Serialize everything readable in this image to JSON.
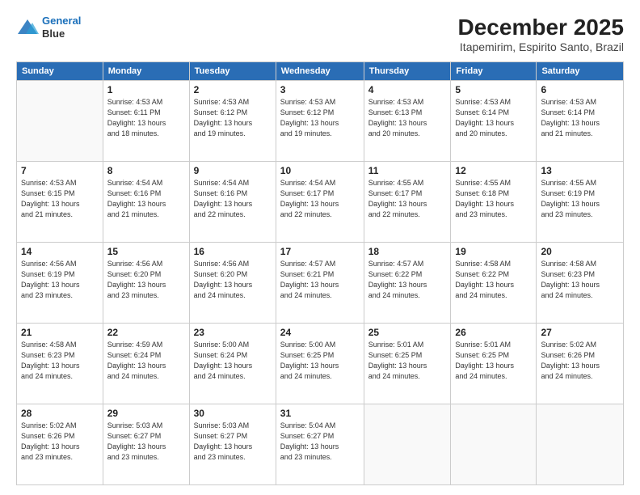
{
  "header": {
    "logo_line1": "General",
    "logo_line2": "Blue",
    "title": "December 2025",
    "subtitle": "Itapemirim, Espirito Santo, Brazil"
  },
  "calendar": {
    "days_of_week": [
      "Sunday",
      "Monday",
      "Tuesday",
      "Wednesday",
      "Thursday",
      "Friday",
      "Saturday"
    ],
    "weeks": [
      [
        {
          "day": "",
          "info": ""
        },
        {
          "day": "1",
          "info": "Sunrise: 4:53 AM\nSunset: 6:11 PM\nDaylight: 13 hours\nand 18 minutes."
        },
        {
          "day": "2",
          "info": "Sunrise: 4:53 AM\nSunset: 6:12 PM\nDaylight: 13 hours\nand 19 minutes."
        },
        {
          "day": "3",
          "info": "Sunrise: 4:53 AM\nSunset: 6:12 PM\nDaylight: 13 hours\nand 19 minutes."
        },
        {
          "day": "4",
          "info": "Sunrise: 4:53 AM\nSunset: 6:13 PM\nDaylight: 13 hours\nand 20 minutes."
        },
        {
          "day": "5",
          "info": "Sunrise: 4:53 AM\nSunset: 6:14 PM\nDaylight: 13 hours\nand 20 minutes."
        },
        {
          "day": "6",
          "info": "Sunrise: 4:53 AM\nSunset: 6:14 PM\nDaylight: 13 hours\nand 21 minutes."
        }
      ],
      [
        {
          "day": "7",
          "info": "Sunrise: 4:53 AM\nSunset: 6:15 PM\nDaylight: 13 hours\nand 21 minutes."
        },
        {
          "day": "8",
          "info": "Sunrise: 4:54 AM\nSunset: 6:16 PM\nDaylight: 13 hours\nand 21 minutes."
        },
        {
          "day": "9",
          "info": "Sunrise: 4:54 AM\nSunset: 6:16 PM\nDaylight: 13 hours\nand 22 minutes."
        },
        {
          "day": "10",
          "info": "Sunrise: 4:54 AM\nSunset: 6:17 PM\nDaylight: 13 hours\nand 22 minutes."
        },
        {
          "day": "11",
          "info": "Sunrise: 4:55 AM\nSunset: 6:17 PM\nDaylight: 13 hours\nand 22 minutes."
        },
        {
          "day": "12",
          "info": "Sunrise: 4:55 AM\nSunset: 6:18 PM\nDaylight: 13 hours\nand 23 minutes."
        },
        {
          "day": "13",
          "info": "Sunrise: 4:55 AM\nSunset: 6:19 PM\nDaylight: 13 hours\nand 23 minutes."
        }
      ],
      [
        {
          "day": "14",
          "info": "Sunrise: 4:56 AM\nSunset: 6:19 PM\nDaylight: 13 hours\nand 23 minutes."
        },
        {
          "day": "15",
          "info": "Sunrise: 4:56 AM\nSunset: 6:20 PM\nDaylight: 13 hours\nand 23 minutes."
        },
        {
          "day": "16",
          "info": "Sunrise: 4:56 AM\nSunset: 6:20 PM\nDaylight: 13 hours\nand 24 minutes."
        },
        {
          "day": "17",
          "info": "Sunrise: 4:57 AM\nSunset: 6:21 PM\nDaylight: 13 hours\nand 24 minutes."
        },
        {
          "day": "18",
          "info": "Sunrise: 4:57 AM\nSunset: 6:22 PM\nDaylight: 13 hours\nand 24 minutes."
        },
        {
          "day": "19",
          "info": "Sunrise: 4:58 AM\nSunset: 6:22 PM\nDaylight: 13 hours\nand 24 minutes."
        },
        {
          "day": "20",
          "info": "Sunrise: 4:58 AM\nSunset: 6:23 PM\nDaylight: 13 hours\nand 24 minutes."
        }
      ],
      [
        {
          "day": "21",
          "info": "Sunrise: 4:58 AM\nSunset: 6:23 PM\nDaylight: 13 hours\nand 24 minutes."
        },
        {
          "day": "22",
          "info": "Sunrise: 4:59 AM\nSunset: 6:24 PM\nDaylight: 13 hours\nand 24 minutes."
        },
        {
          "day": "23",
          "info": "Sunrise: 5:00 AM\nSunset: 6:24 PM\nDaylight: 13 hours\nand 24 minutes."
        },
        {
          "day": "24",
          "info": "Sunrise: 5:00 AM\nSunset: 6:25 PM\nDaylight: 13 hours\nand 24 minutes."
        },
        {
          "day": "25",
          "info": "Sunrise: 5:01 AM\nSunset: 6:25 PM\nDaylight: 13 hours\nand 24 minutes."
        },
        {
          "day": "26",
          "info": "Sunrise: 5:01 AM\nSunset: 6:25 PM\nDaylight: 13 hours\nand 24 minutes."
        },
        {
          "day": "27",
          "info": "Sunrise: 5:02 AM\nSunset: 6:26 PM\nDaylight: 13 hours\nand 24 minutes."
        }
      ],
      [
        {
          "day": "28",
          "info": "Sunrise: 5:02 AM\nSunset: 6:26 PM\nDaylight: 13 hours\nand 23 minutes."
        },
        {
          "day": "29",
          "info": "Sunrise: 5:03 AM\nSunset: 6:27 PM\nDaylight: 13 hours\nand 23 minutes."
        },
        {
          "day": "30",
          "info": "Sunrise: 5:03 AM\nSunset: 6:27 PM\nDaylight: 13 hours\nand 23 minutes."
        },
        {
          "day": "31",
          "info": "Sunrise: 5:04 AM\nSunset: 6:27 PM\nDaylight: 13 hours\nand 23 minutes."
        },
        {
          "day": "",
          "info": ""
        },
        {
          "day": "",
          "info": ""
        },
        {
          "day": "",
          "info": ""
        }
      ]
    ]
  }
}
